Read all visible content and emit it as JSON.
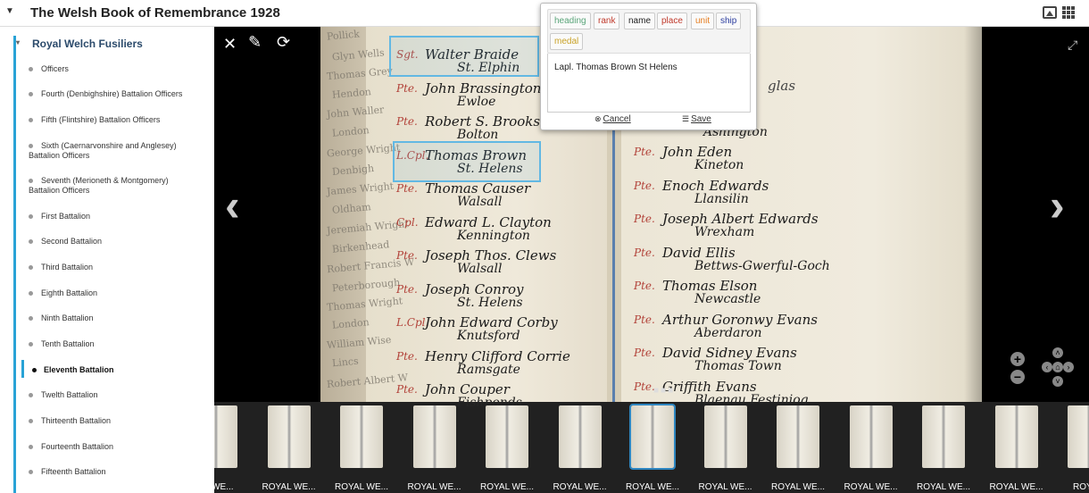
{
  "app": {
    "title": "The Welsh Book of Remembrance 1928"
  },
  "sidebar": {
    "section_title": "Royal Welch Fusiliers",
    "items": [
      {
        "label": "Officers"
      },
      {
        "label": "Fourth (Denbighshire) Battalion Officers"
      },
      {
        "label": "Fifth (Flintshire) Battalion Officers"
      },
      {
        "label": "Sixth (Caernarvonshire and Anglesey) Battalion Officers"
      },
      {
        "label": "Seventh (Merioneth & Montgomery) Battalion Officers"
      },
      {
        "label": "First Battalion"
      },
      {
        "label": "Second Battalion"
      },
      {
        "label": "Third Battalion"
      },
      {
        "label": "Eighth Battalion"
      },
      {
        "label": "Ninth Battalion"
      },
      {
        "label": "Tenth Battalion"
      },
      {
        "label": "Eleventh Battalion",
        "active": true
      },
      {
        "label": "Twelth Battalion"
      },
      {
        "label": "Thirteenth Battalion"
      },
      {
        "label": "Fourteenth Battalion"
      },
      {
        "label": "Fifteenth Battalion"
      }
    ]
  },
  "viewer": {
    "tools": {
      "close_icon": "close-icon",
      "edit_icon": "edit-icon",
      "refresh_icon": "refresh-icon"
    },
    "left_ghost": [
      "Pollick",
      "Glyn Wells",
      "Thomas Grey",
      "Hendon",
      "John Waller",
      "London",
      "George Wright",
      "Denbigh",
      "James Wright",
      "Oldham",
      "Jeremiah Wright",
      "Birkenhead",
      "Robert Francis W",
      "Peterborough",
      "Thomas Wright",
      "London",
      "William Wise",
      "Lincs",
      "Robert Albert W"
    ],
    "left_entries": [
      {
        "rank": "Sgt.",
        "name": "Walter Braide",
        "place": "St. Elphin"
      },
      {
        "rank": "Pte.",
        "name": "John Brassington",
        "place": "Ewloe"
      },
      {
        "rank": "Pte.",
        "name": "Robert S. Brooks",
        "place": "Bolton"
      },
      {
        "rank": "L.Cpl.",
        "name": "Thomas Brown",
        "place": "St. Helens"
      },
      {
        "rank": "Pte.",
        "name": "Thomas Causer",
        "place": "Walsall"
      },
      {
        "rank": "Cpl.",
        "name": "Edward L. Clayton",
        "place": "Kennington"
      },
      {
        "rank": "Pte.",
        "name": "Joseph Thos. Clews",
        "place": "Walsall"
      },
      {
        "rank": "Pte.",
        "name": "Joseph Conroy",
        "place": "St. Helens"
      },
      {
        "rank": "L.Cpl.",
        "name": "John Edward Corby",
        "place": "Knutsford"
      },
      {
        "rank": "Pte.",
        "name": "Henry Clifford Corrie",
        "place": "Ramsgate"
      },
      {
        "rank": "Pte.",
        "name": "John Couper",
        "place": "Fishponds"
      }
    ],
    "right_entries": [
      {
        "rank": "Pte.",
        "name": "John Eden",
        "place": "Kineton"
      },
      {
        "rank": "Pte.",
        "name": "Enoch Edwards",
        "place": "Llansilin"
      },
      {
        "rank": "Pte.",
        "name": "Joseph Albert Edwards",
        "place": "Wrexham"
      },
      {
        "rank": "Pte.",
        "name": "David Ellis",
        "place": "Bettws-Gwerful-Goch"
      },
      {
        "rank": "Pte.",
        "name": "Thomas Elson",
        "place": "Newcastle"
      },
      {
        "rank": "Pte.",
        "name": "Arthur Goronwy Evans",
        "place": "Aberdaron"
      },
      {
        "rank": "Pte.",
        "name": "David Sidney Evans",
        "place": "Thomas Town"
      },
      {
        "rank": "Pte.",
        "name": "Griffith Evans",
        "place": "Blaenau Festiniog"
      }
    ],
    "right_top": {
      "name": "Ashington",
      "partial": "glas"
    },
    "thumbnail_labels": [
      "AL WE...",
      "ROYAL WE...",
      "ROYAL WE...",
      "ROYAL WE...",
      "ROYAL WE...",
      "ROYAL WE...",
      "ROYAL WE...",
      "ROYAL WE...",
      "ROYAL WE...",
      "ROYAL WE...",
      "ROYAL WE...",
      "ROYAL WE...",
      "ROYA..."
    ],
    "selected_thumbnail_index": 6
  },
  "popup": {
    "tags": [
      "heading",
      "rank",
      "name",
      "place",
      "unit",
      "ship",
      "medal"
    ],
    "tag_colors": {
      "heading": "#5aa57a",
      "rank": "#c0392b",
      "name": "#222222",
      "place": "#c0392b",
      "unit": "#e67e22",
      "ship": "#2c3e9f",
      "medal": "#c9a227"
    },
    "text": "Lapl. Thomas Brown St Helens",
    "cancel_label": "Cancel",
    "save_label": "Save"
  },
  "colors": {
    "accent": "#29a3d6",
    "highlight": "#62b8e3"
  }
}
